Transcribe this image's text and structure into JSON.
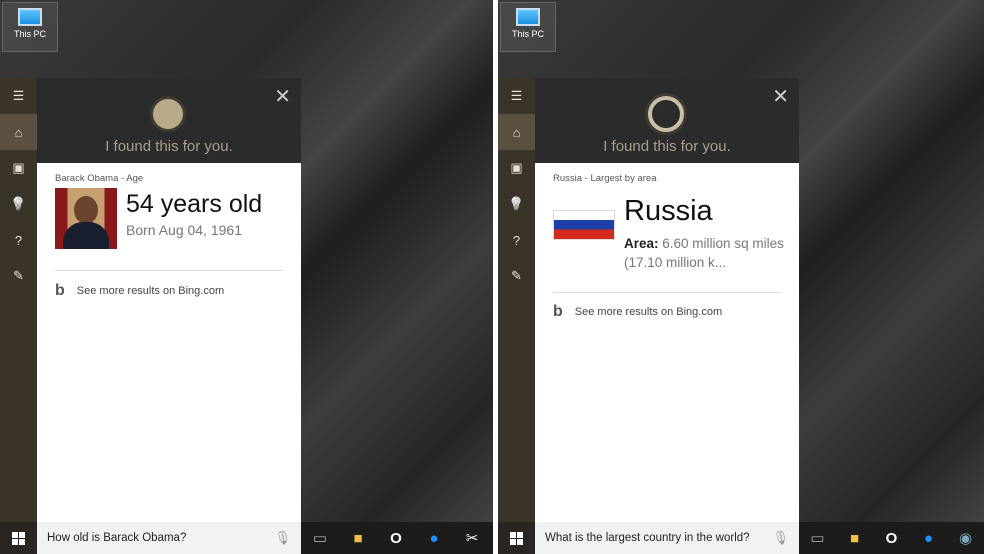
{
  "desktop": {
    "this_pc_label": "This PC"
  },
  "left": {
    "header": "I found this for you.",
    "subtitle": "Barack Obama - Age",
    "answer": "54 years old",
    "detail": "Born Aug 04, 1961",
    "bing_link": "See more results on Bing.com",
    "query": "How old is Barack Obama?"
  },
  "right": {
    "header": "I found this for you.",
    "subtitle": "Russia - Largest by area",
    "answer": "Russia",
    "area_label": "Area:",
    "area_value": "6.60 million sq miles (17.10 million k...",
    "bing_link": "See more results on Bing.com",
    "query": "What is the largest country in the world?"
  },
  "icons": {
    "close": "✕",
    "menu": "☰",
    "home": "⌂",
    "notebook": "▣",
    "lightbulb": "💡",
    "help": "?",
    "feedback": "✎",
    "mic": "🎙"
  },
  "colors": {
    "sidebar": "#3a3328",
    "header": "#2b2b2b",
    "accent": "#b8ab8a"
  }
}
